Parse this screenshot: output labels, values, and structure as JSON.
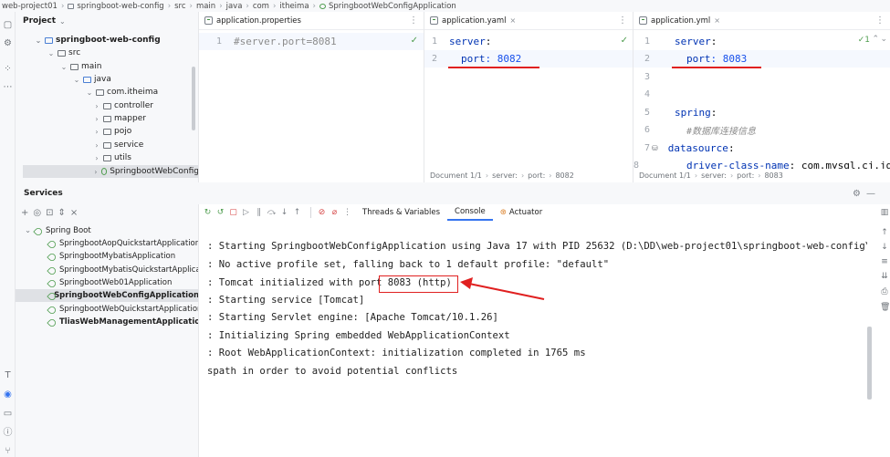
{
  "breadcrumb": [
    "web-project01",
    "springboot-web-config",
    "src",
    "main",
    "java",
    "com",
    "itheima",
    "SpringbootWebConfigApplication"
  ],
  "project_panel": {
    "title": "Project",
    "tree": [
      {
        "label": "springboot-web-config",
        "bold": true
      },
      {
        "label": "src"
      },
      {
        "label": "main"
      },
      {
        "label": "java"
      },
      {
        "label": "com.itheima"
      },
      {
        "label": "controller"
      },
      {
        "label": "mapper"
      },
      {
        "label": "pojo"
      },
      {
        "label": "service"
      },
      {
        "label": "utils"
      },
      {
        "label": "SpringbootWebConfig"
      }
    ]
  },
  "editors": [
    {
      "tab": "application.properties",
      "lines": [
        {
          "num": "1",
          "text": "#server.port=8081"
        }
      ],
      "status": []
    },
    {
      "tab": "application.yaml",
      "lines": [
        {
          "num": "1",
          "key": "server",
          "val": ":"
        },
        {
          "num": "2",
          "key": "port",
          "val": ": 8082"
        }
      ],
      "status": [
        "Document 1/1",
        "server:",
        "port:",
        "8082"
      ]
    },
    {
      "tab": "application.yml",
      "lines": [
        {
          "num": "1",
          "key": "server",
          "val": ":"
        },
        {
          "num": "2",
          "key": "port",
          "val": ": 8083"
        },
        {
          "num": "3",
          "text": ""
        },
        {
          "num": "4",
          "text": ""
        },
        {
          "num": "5",
          "key": "spring",
          "val": ":"
        },
        {
          "num": "6",
          "comment": "#数据库连接信息"
        },
        {
          "num": "7",
          "key": "datasource",
          "val": ":"
        },
        {
          "num": "8",
          "key": "driver-class-name",
          "val": ": com.mysql.cj.jd"
        }
      ],
      "inspection": "✓1",
      "status": [
        "Document 1/1",
        "server:",
        "port:",
        "8083"
      ]
    }
  ],
  "services": {
    "title": "Services",
    "root": "Spring Boot",
    "apps": [
      {
        "label": "SpringbootAopQuickstartApplication",
        "bold": false
      },
      {
        "label": "SpringbootMybatisApplication",
        "bold": false
      },
      {
        "label": "SpringbootMybatisQuickstartApplication",
        "bold": false
      },
      {
        "label": "SpringbootWeb01Application",
        "bold": false
      },
      {
        "label": "SpringbootWebConfigApplication",
        "bold": true
      },
      {
        "label": "SpringbootWebQuickstartApplication",
        "bold": false
      },
      {
        "label": "TliasWebManagementApplication",
        "bold": true
      }
    ]
  },
  "console_tabs": [
    "Threads & Variables",
    "Console",
    "Actuator"
  ],
  "console": [
    ": Starting SpringbootWebConfigApplication using Java 17 with PID 25632 (D:\\DD\\web-project01\\springboot-web-config\\tar",
    ": No active profile set, falling back to 1 default profile: \"default\"",
    ": Tomcat initialized with port 8083 (http)",
    ": Starting service [Tomcat]",
    ": Starting Servlet engine: [Apache Tomcat/10.1.26]",
    ": Initializing Spring embedded WebApplicationContext",
    ": Root WebApplicationContext: initialization completed in 1765 ms",
    "spath in order to avoid potential conflicts"
  ],
  "colors": {
    "accent": "#3574f0",
    "annotation": "#e02020",
    "keyword": "#0033b3",
    "number": "#1750eb"
  }
}
